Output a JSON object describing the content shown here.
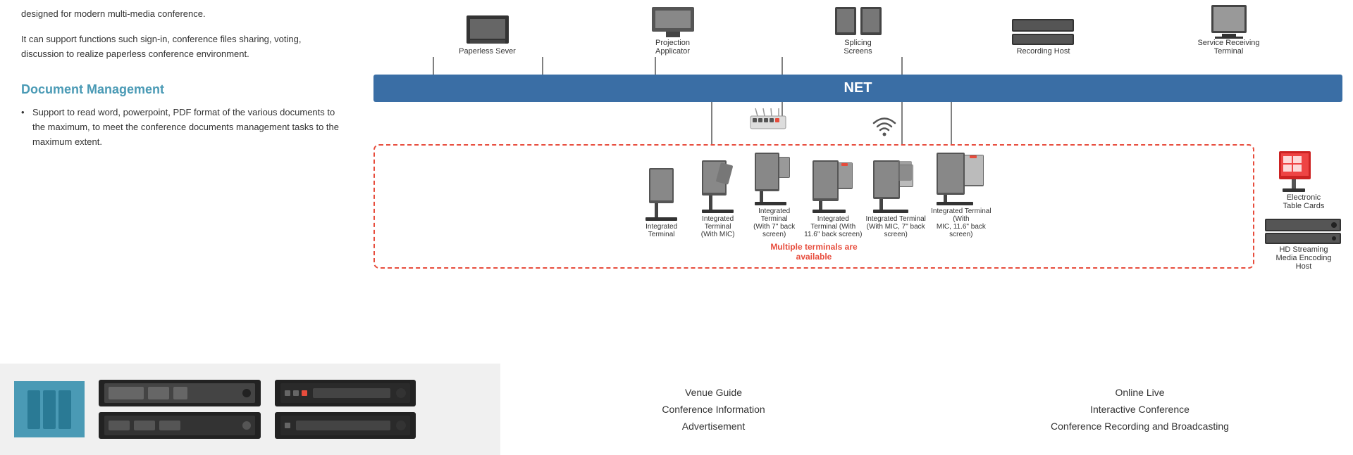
{
  "left": {
    "intro_text_1": "designed for modern multi-media conference.",
    "intro_text_2": "It can support functions such sign-in, conference files sharing, voting, discussion to realize paperless conference environment.",
    "section_title": "Document Management",
    "bullet_points": [
      "Support to read word, powerpoint, PDF format of the various documents to the maximum, to meet the conference documents management tasks to the maximum extent."
    ]
  },
  "diagram": {
    "net_label": "NET",
    "top_devices": [
      {
        "label": "Paperless Sever",
        "id": "paperless-server"
      },
      {
        "label": "Projection\nApplicator",
        "id": "projection-applicator"
      },
      {
        "label": "Splicing\nScreens",
        "id": "splicing-screens"
      },
      {
        "label": "Recording Host",
        "id": "recording-host"
      },
      {
        "label": "Service Receiving\nTerminal",
        "id": "service-receiving-terminal"
      }
    ],
    "terminals": [
      {
        "label": "Integrated\nTerminal",
        "id": "t1"
      },
      {
        "label": "Integrated\nTerminal\n(With MIC)",
        "id": "t2"
      },
      {
        "label": "Integrated\nTerminal\n(With 7\" back\nscreen)",
        "id": "t3"
      },
      {
        "label": "Integrated\nTerminal (With\n11.6\" back screen)",
        "id": "t4"
      },
      {
        "label": "Integrated Terminal\n(With MIC, 7\" back\nscreen)",
        "id": "t5"
      },
      {
        "label": "Integrated Terminal (With\nMIC, 11.6\" back screen)",
        "id": "t6"
      }
    ],
    "multiple_text": "Multiple terminals are\navailable",
    "right_devices": [
      {
        "label": "Electronic\nTable Cards",
        "id": "electronic-table-cards"
      },
      {
        "label": "HD Streaming\nMedia Encoding\nHost",
        "id": "hd-streaming"
      }
    ]
  },
  "footer": {
    "links_left": [
      "Venue Guide",
      "Conference Information",
      "Advertisement"
    ],
    "links_right": [
      "Online Live",
      "Interactive Conference",
      "Conference Recording and Broadcasting"
    ]
  }
}
